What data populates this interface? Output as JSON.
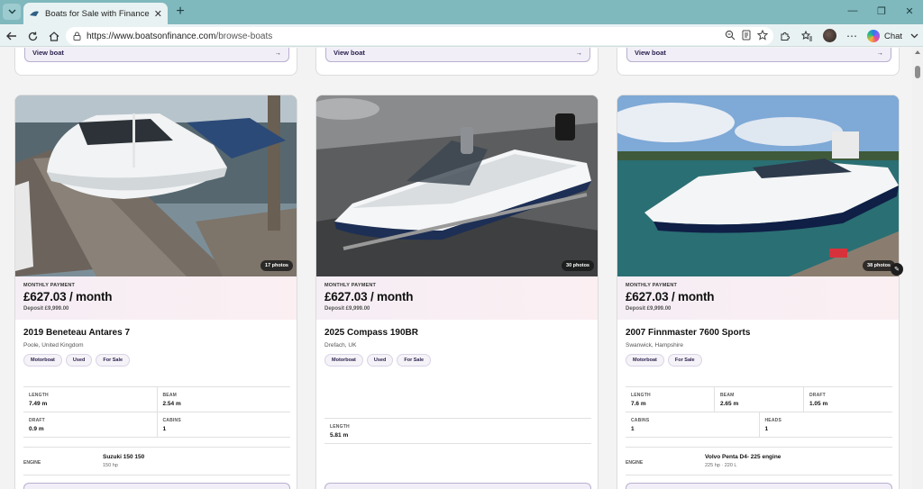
{
  "browser": {
    "tab_title": "Boats for Sale with Finance | Boats",
    "url_host": "https://www.boatsonfinance.com",
    "url_path": "/browse-boats",
    "chat_label": "Chat"
  },
  "previous_row": {
    "view_label": "View boat",
    "arrow": "→"
  },
  "listing": {
    "monthly_label": "MONTHLY PAYMENT",
    "cards": [
      {
        "photos": "17 photos",
        "amount": "£627.03 / month",
        "deposit": "Deposit £9,999.00",
        "name": "2019 Beneteau Antares 7",
        "location": "Poole, United Kingdom",
        "tags": [
          "Motorboat",
          "Used",
          "For Sale"
        ],
        "specs": {
          "length_label": "LENGTH",
          "length": "7.49 m",
          "beam_label": "BEAM",
          "beam": "2.54 m",
          "draft_label": "DRAFT",
          "draft": "0.9 m",
          "cabins_label": "CABINS",
          "cabins": "1"
        },
        "engine": {
          "label": "ENGINE",
          "name": "Suzuki 150 150",
          "detail": "150 hp"
        }
      },
      {
        "photos": "30 photos",
        "amount": "£627.03 / month",
        "deposit": "Deposit £9,999.00",
        "name": "2025 Compass 190BR",
        "location": "Drefach, UK",
        "tags": [
          "Motorboat",
          "Used",
          "For Sale"
        ],
        "specs": {
          "length_label": "LENGTH",
          "length": "5.81 m"
        }
      },
      {
        "photos": "38 photos",
        "amount": "£627.03 / month",
        "deposit": "Deposit £9,999.00",
        "name": "2007 Finnmaster 7600 Sports",
        "location": "Swanwick, Hampshire",
        "tags": [
          "Motorboat",
          "For Sale"
        ],
        "specs": {
          "length_label": "LENGTH",
          "length": "7.6 m",
          "beam_label": "BEAM",
          "beam": "2.65 m",
          "draft_label": "DRAFT",
          "draft": "1.05 m",
          "cabins_label": "CABINS",
          "cabins": "1",
          "heads_label": "HEADS",
          "heads": "1"
        },
        "engine": {
          "label": "ENGINE",
          "name": "Volvo Penta D4- 225 engine",
          "detail": "225 hp · 220 L"
        }
      }
    ]
  }
}
